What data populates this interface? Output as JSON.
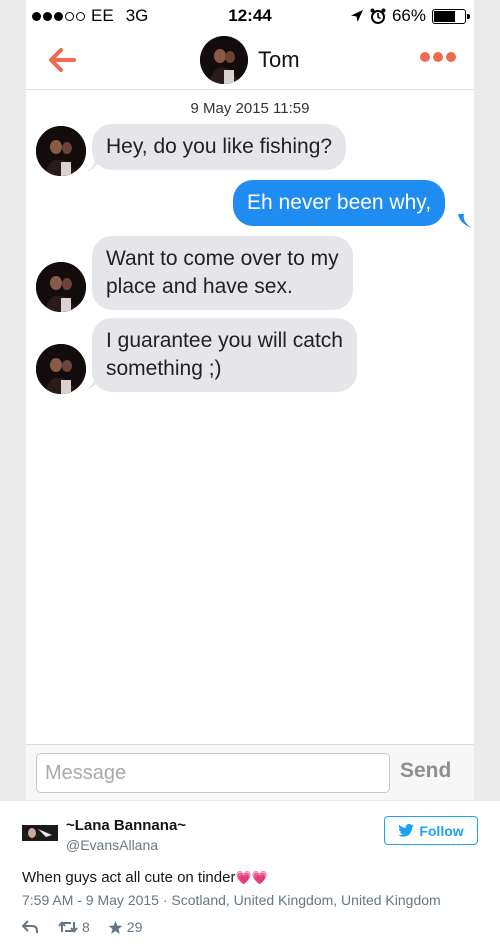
{
  "status_bar": {
    "carrier": "EE",
    "network": "3G",
    "time": "12:44",
    "battery": "66%",
    "signal_bars": 3
  },
  "nav": {
    "contact_name": "Tom",
    "back_icon": "back-arrow-icon",
    "more_icon": "more-dots-icon",
    "accent_color": "#f06a4f"
  },
  "chat": {
    "timestamp": "9 May 2015 11:59",
    "messages": [
      {
        "direction": "in",
        "text": "Hey, do you like fishing?"
      },
      {
        "direction": "out",
        "text": "Eh never been why,"
      },
      {
        "direction": "in",
        "text_lines": [
          "Want to come over to my",
          "place and have sex."
        ]
      },
      {
        "direction": "in",
        "text_lines": [
          "I guarantee you will catch",
          "something ;)"
        ]
      }
    ],
    "incoming_color": "#e5e5ea",
    "outgoing_color": "#1e8cf0"
  },
  "composer": {
    "placeholder": "Message",
    "send_label": "Send"
  },
  "tweet": {
    "display_name": "~Lana Bannana~",
    "handle": "@EvansAllana",
    "follow_label": "Follow",
    "text": "When guys act all cute on tinder",
    "emoji": "💗💗",
    "meta": "7:59 AM - 9 May 2015 · Scotland, United Kingdom, United Kingdom",
    "retweets": "8",
    "likes": "29",
    "brand_color": "#1da1f2"
  }
}
